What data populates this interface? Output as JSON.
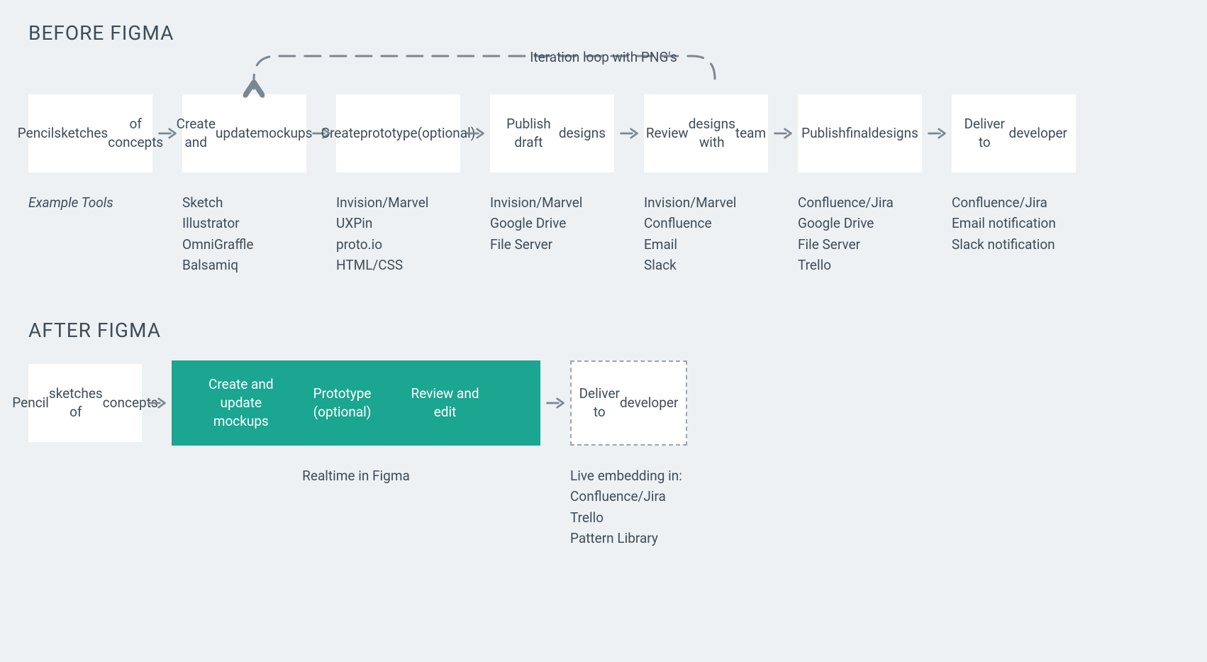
{
  "before": {
    "heading": "BEFORE FIGMA",
    "loop_label": "Iteration loop with PNG's",
    "tools_label": "Example Tools",
    "steps": [
      {
        "title": [
          "Pencil",
          "sketches",
          "of concepts"
        ],
        "tools": []
      },
      {
        "title": [
          "Create and",
          "update",
          "mockups"
        ],
        "tools": [
          "Sketch",
          "Illustrator",
          "OmniGraffle",
          "Balsamiq"
        ]
      },
      {
        "title": [
          "Create",
          "prototype",
          "(optional)"
        ],
        "tools": [
          "Invision/Marvel",
          "UXPin",
          "proto.io",
          "HTML/CSS"
        ]
      },
      {
        "title": [
          "Publish draft",
          "designs"
        ],
        "tools": [
          "Invision/Marvel",
          "Google Drive",
          "File Server"
        ]
      },
      {
        "title": [
          "Review",
          "designs with",
          "team"
        ],
        "tools": [
          "Invision/Marvel",
          "Confluence",
          "Email",
          "Slack"
        ]
      },
      {
        "title": [
          "Publish",
          "final",
          "designs"
        ],
        "tools": [
          "Confluence/Jira",
          "Google Drive",
          "File Server",
          "Trello"
        ]
      },
      {
        "title": [
          "Deliver to",
          "developer"
        ],
        "tools": [
          "Confluence/Jira",
          "Email notification",
          "Slack notification"
        ]
      }
    ]
  },
  "after": {
    "heading": "AFTER FIGMA",
    "step0": [
      "Pencil",
      "sketches of",
      "concepts"
    ],
    "figma_steps": [
      [
        "Create and",
        "update",
        "mockups"
      ],
      [
        "Prototype",
        "(optional)"
      ],
      [
        "Review and",
        "edit"
      ]
    ],
    "figma_caption": "Realtime in Figma",
    "deliver": [
      "Deliver to",
      "developer"
    ],
    "deliver_tools": [
      "Live embedding in:",
      "Confluence/Jira",
      "Trello",
      "Pattern Library"
    ]
  },
  "layout": {
    "before_box_w": 175,
    "before_arrow_w": 42,
    "after_box0_w": 160,
    "after_arrow_w": 42,
    "after_teal_w": 520,
    "after_dashed_w": 165
  }
}
